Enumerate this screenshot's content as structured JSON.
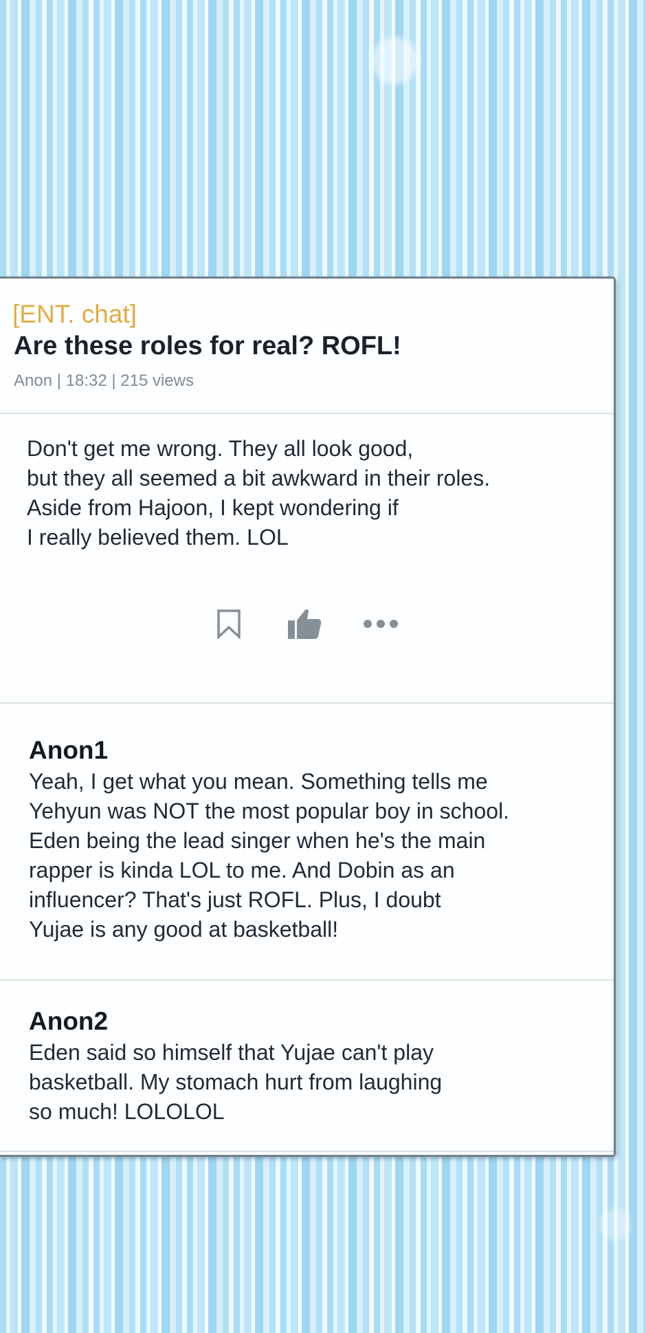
{
  "post": {
    "category": "[ENT. chat]",
    "title": "Are these roles for real? ROFL!",
    "meta": "Anon | 18:32 | 215 views",
    "body": "Don't get me wrong. They all look good,\nbut they all seemed a bit awkward in their roles.\nAside from Hajoon, I kept wondering if\nI really believed them. LOL",
    "actions": {
      "bookmark_icon": "bookmark-icon",
      "like_icon": "thumbs-up-icon",
      "more_icon": "ellipsis-icon"
    }
  },
  "comments": [
    {
      "author": "Anon1",
      "text": "Yeah, I get what you mean. Something tells me\nYehyun was NOT the most popular boy in school.\nEden being the lead singer when he's the main\nrapper is kinda LOL to me. And Dobin as an\ninfluencer? That's just ROFL. Plus, I doubt\nYujae is any good at basketball!"
    },
    {
      "author": "Anon2",
      "text": "Eden said so himself that Yujae can't play\nbasketball. My stomach hurt from laughing\nso much! LOLOLOL"
    }
  ],
  "colors": {
    "category": "#e3ab43",
    "title": "#18222c",
    "meta": "#818b93",
    "icon": "#868f96",
    "card_border": "#70808c",
    "background": "#c9e8f7"
  }
}
